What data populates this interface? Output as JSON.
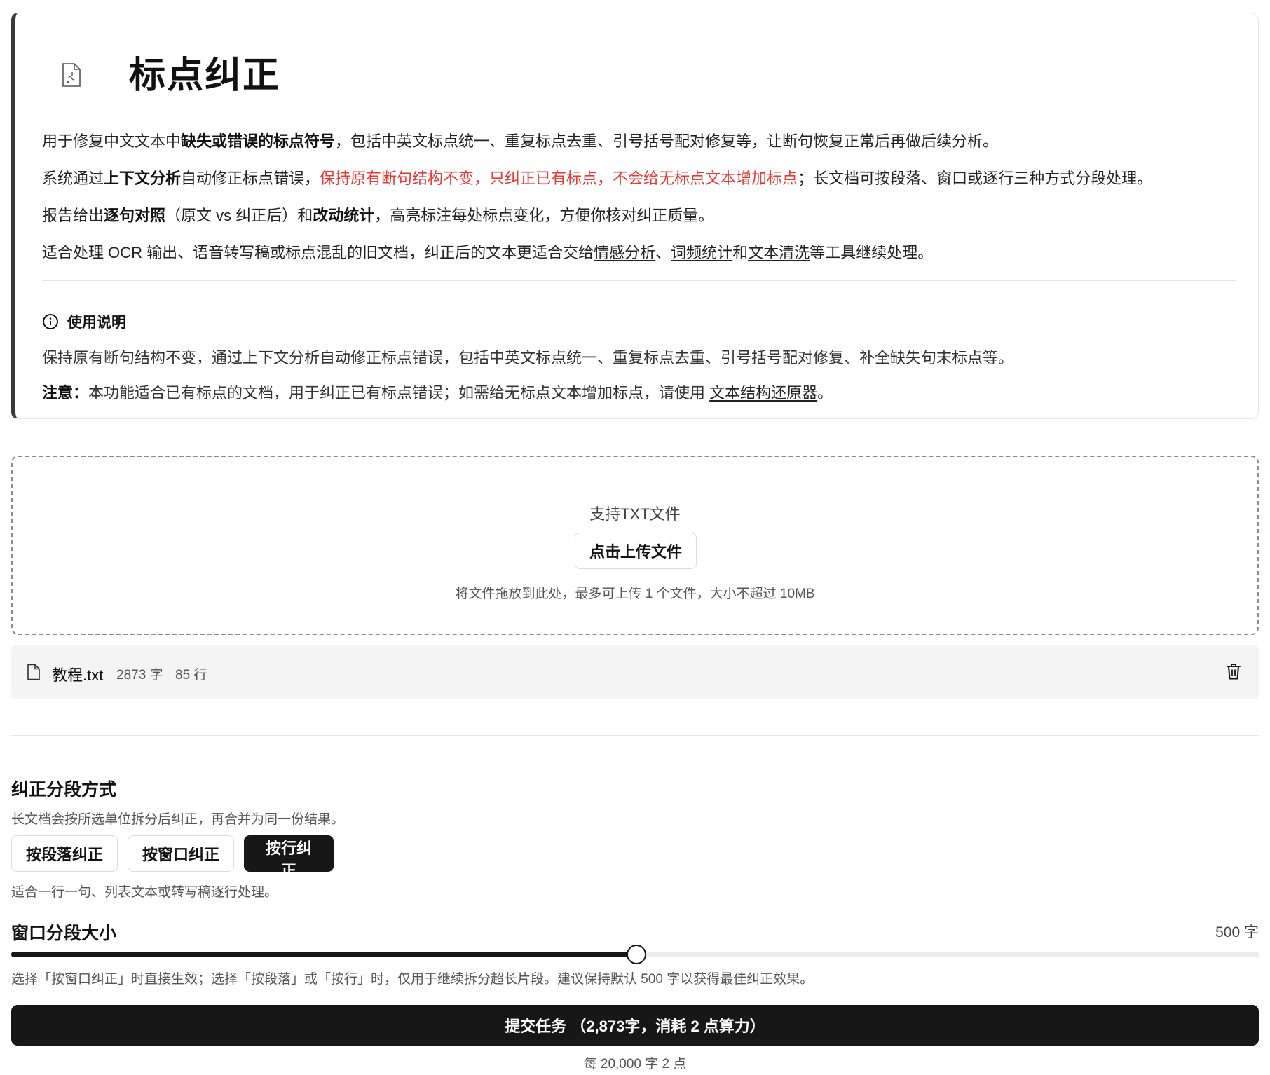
{
  "header": {
    "title": "标点纠正"
  },
  "intro": {
    "p1": {
      "t1": "用于修复中文文本中",
      "b1": "缺失或错误的标点符号",
      "t2": "，包括中英文标点统一、重复标点去重、引号括号配对修复等，让断句恢复正常后再做后续分析。"
    },
    "p2": {
      "t1": "系统通过",
      "b1": "上下文分析",
      "t2": "自动修正标点错误，",
      "red": "保持原有断句结构不变，只纠正已有标点，不会给无标点文本增加标点",
      "t3": "；长文档可按段落、窗口或逐行三种方式分段处理。"
    },
    "p3": {
      "t1": "报告给出",
      "b1": "逐句对照",
      "t2": "（原文 vs 纠正后）和",
      "b2": "改动统计",
      "t3": "，高亮标注每处标点变化，方便你核对纠正质量。"
    },
    "p4": {
      "t1": "适合处理 OCR 输出、语音转写稿或标点混乱的旧文档，纠正后的文本更适合交给",
      "l1": "情感分析",
      "sep1": "、",
      "l2": "词频统计",
      "sep2": "和",
      "l3": "文本清洗",
      "t2": "等工具继续处理。"
    }
  },
  "usage": {
    "title": "使用说明",
    "text": "保持原有断句结构不变，通过上下文分析自动修正标点错误，包括中英文标点统一、重复标点去重、引号括号配对修复、补全缺失句末标点等。",
    "note_label": "注意：",
    "note_text": "本功能适合已有标点的文档，用于纠正已有标点错误；如需给无标点文本增加标点，请使用 ",
    "note_link": "文本结构还原器",
    "note_end": "。"
  },
  "upload": {
    "hint": "支持TXT文件",
    "button": "点击上传文件",
    "sub": "将文件拖放到此处，最多可上传 1 个文件，大小不超过 10MB"
  },
  "file": {
    "name": "教程.txt",
    "chars": "2873 字",
    "lines": "85 行"
  },
  "segmentation": {
    "title": "纠正分段方式",
    "desc": "长文档会按所选单位拆分后纠正，再合并为同一份结果。",
    "options": [
      "按段落纠正",
      "按窗口纠正",
      "按行纠正"
    ],
    "selected": "按行纠正",
    "hint": "适合一行一句、列表文本或转写稿逐行处理。"
  },
  "window": {
    "title": "窗口分段大小",
    "value_label": "500 字",
    "slider_fraction": 0.501,
    "hint": "选择「按窗口纠正」时直接生效；选择「按段落」或「按行」时，仅用于继续拆分超长片段。建议保持默认 500 字以获得最佳纠正效果。"
  },
  "submit": {
    "label": "提交任务 （2,873字，消耗 2 点算力）",
    "price_note": "每 20,000 字 2 点"
  }
}
